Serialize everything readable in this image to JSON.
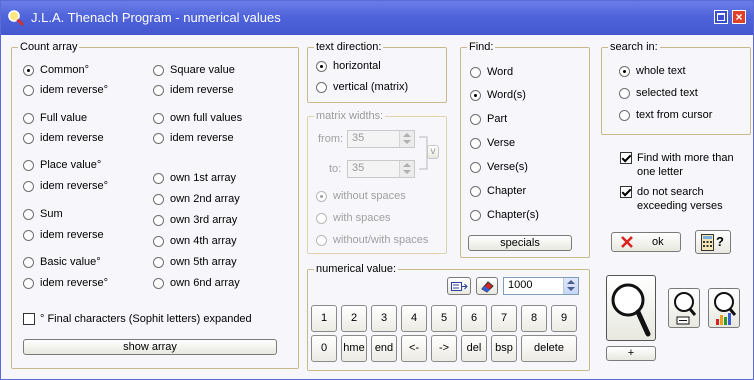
{
  "window": {
    "title": "J.L.A. Thenach Program - numerical values"
  },
  "count_array": {
    "title": "Count array",
    "left": [
      {
        "label": "Common°",
        "checked": true
      },
      {
        "label": "idem reverse°",
        "checked": false
      },
      {
        "label": "Full value",
        "checked": false
      },
      {
        "label": "idem reverse",
        "checked": false
      },
      {
        "label": "Place value°",
        "checked": false
      },
      {
        "label": "idem reverse°",
        "checked": false
      },
      {
        "label": "Sum",
        "checked": false
      },
      {
        "label": "idem reverse",
        "checked": false
      },
      {
        "label": "Basic value°",
        "checked": false
      },
      {
        "label": "idem reverse°",
        "checked": false
      }
    ],
    "right": [
      {
        "label": "Square value",
        "checked": false
      },
      {
        "label": "idem reverse",
        "checked": false
      },
      {
        "label": "own full values",
        "checked": false
      },
      {
        "label": "idem reverse",
        "checked": false
      },
      {
        "label": "own 1st array",
        "checked": false
      },
      {
        "label": "own 2nd array",
        "checked": false
      },
      {
        "label": "own 3rd array",
        "checked": false
      },
      {
        "label": "own 4th array",
        "checked": false
      },
      {
        "label": "own 5th array",
        "checked": false
      },
      {
        "label": "own 6nd array",
        "checked": false
      }
    ],
    "final_chars_label": "° Final characters (Sophit letters) expanded",
    "show_array_label": "show array"
  },
  "text_direction": {
    "title": "text direction:",
    "options": [
      {
        "label": "horizontal",
        "checked": true
      },
      {
        "label": "vertical (matrix)",
        "checked": false
      }
    ]
  },
  "matrix_widths": {
    "title": "matrix widths:",
    "from_label": "from:",
    "from_value": "35",
    "to_label": "to:",
    "to_value": "35",
    "link_label": "v",
    "options": [
      {
        "label": "without spaces",
        "checked": true
      },
      {
        "label": "with spaces",
        "checked": false
      },
      {
        "label": "without/with spaces",
        "checked": false
      }
    ]
  },
  "find": {
    "title": "Find:",
    "options": [
      {
        "label": "Word",
        "checked": false
      },
      {
        "label": "Word(s)",
        "checked": true
      },
      {
        "label": "Part",
        "checked": false
      },
      {
        "label": "Verse",
        "checked": false
      },
      {
        "label": "Verse(s)",
        "checked": false
      },
      {
        "label": "Chapter",
        "checked": false
      },
      {
        "label": "Chapter(s)",
        "checked": false
      }
    ],
    "specials_label": "specials"
  },
  "search_in": {
    "title": "search in:",
    "options": [
      {
        "label": "whole text",
        "checked": true
      },
      {
        "label": "selected text",
        "checked": false
      },
      {
        "label": "text from cursor",
        "checked": false
      }
    ]
  },
  "options": {
    "find_more_label": "Find with more than one letter",
    "no_exceed_label": "do not search exceeding verses"
  },
  "numerical_value": {
    "title": "numerical value:",
    "value": "1000",
    "keys_row1": [
      "1",
      "2",
      "3",
      "4",
      "5",
      "6",
      "7",
      "8",
      "9"
    ],
    "keys_row2": [
      "0",
      "hme",
      "end",
      "<-",
      "->",
      "del",
      "bsp",
      "delete"
    ]
  },
  "actions": {
    "ok_label": "ok",
    "help_label": "?",
    "plus_label": "+"
  },
  "colors": {
    "titlebar": "#4f64da",
    "group_border": "#c7b98a",
    "close_red": "#e0402a"
  }
}
